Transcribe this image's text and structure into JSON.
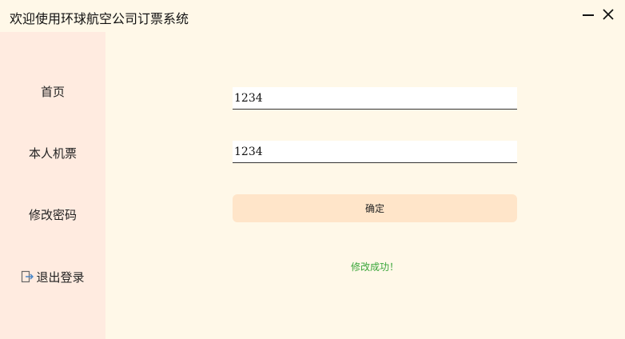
{
  "window": {
    "title": "欢迎使用环球航空公司订票系统",
    "minimize_icon": "minimize-icon",
    "close_icon": "close-icon"
  },
  "sidebar": {
    "items": [
      {
        "label": "首页"
      },
      {
        "label": "本人机票"
      },
      {
        "label": "修改密码"
      },
      {
        "label": "退出登录",
        "icon": "logout-icon"
      }
    ]
  },
  "form": {
    "password_value": "1234",
    "confirm_value": "1234",
    "confirm_button_label": "确定",
    "status_message": "修改成功！"
  },
  "colors": {
    "background": "#fff8e8",
    "sidebar": "#ffebe0",
    "button": "#ffe5c9",
    "success_text": "#3aa63a",
    "logout_icon_accent": "#4a86c8"
  }
}
